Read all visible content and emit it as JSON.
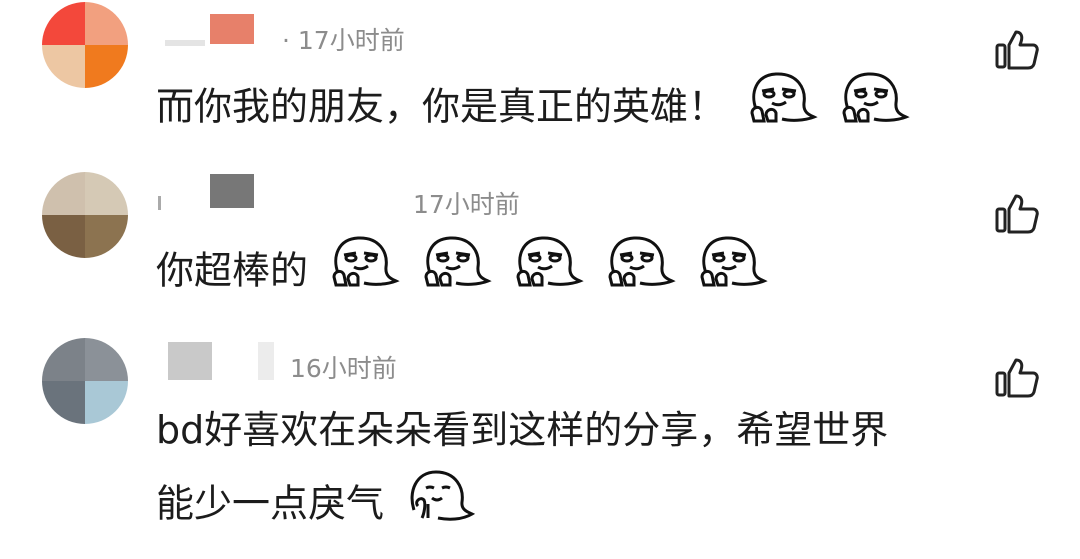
{
  "comments": [
    {
      "time": "· 17小时前",
      "text": "而你我的朋友，你是真正的英雄！",
      "emojis": [
        "smirk-thumbs-emoji",
        "smirk-thumbs-emoji"
      ],
      "avatar_colors": [
        "#f3483b",
        "#f2a07f",
        "#edc7a3",
        "#f07a1e"
      ]
    },
    {
      "time": "17小时前",
      "text": "你超棒的",
      "emojis": [
        "smirk-thumbs-emoji",
        "smirk-thumbs-emoji",
        "smirk-thumbs-emoji",
        "smirk-thumbs-emoji",
        "smirk-thumbs-emoji"
      ],
      "avatar_colors": [
        "#cfc0ad",
        "#d5c9b5",
        "#7a6043",
        "#8c7350"
      ]
    },
    {
      "time": "16小时前",
      "text_line1": "bd好喜欢在朵朵看到这样的分享，希望世界",
      "text_line2": "能少一点戾气",
      "emojis": [
        "shy-ghost-emoji"
      ],
      "avatar_colors": [
        "#7c8289",
        "#8b9198",
        "#6a737c",
        "#a9c8d6"
      ]
    }
  ],
  "icons": {
    "like": "thumbs-up-icon"
  }
}
